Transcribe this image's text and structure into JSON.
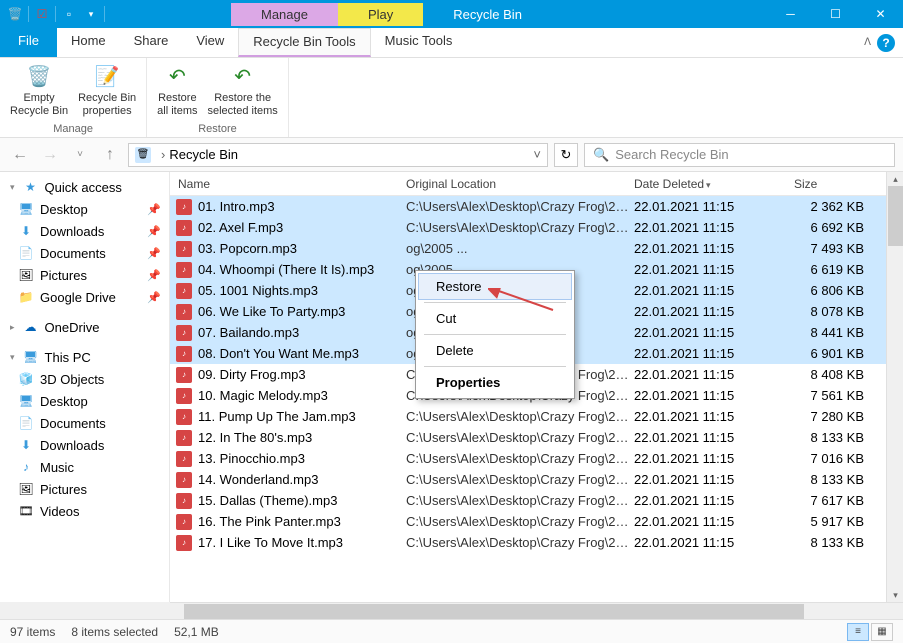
{
  "window": {
    "title": "Recycle Bin",
    "context_manage": "Manage",
    "context_play": "Play"
  },
  "tabs": {
    "file": "File",
    "home": "Home",
    "share": "Share",
    "view": "View",
    "recycle": "Recycle Bin Tools",
    "music": "Music Tools"
  },
  "ribbon": {
    "empty": "Empty\nRecycle Bin",
    "props": "Recycle Bin\nproperties",
    "restore_all": "Restore\nall items",
    "restore_sel": "Restore the\nselected items",
    "group_manage": "Manage",
    "group_restore": "Restore"
  },
  "address": {
    "path": "Recycle Bin",
    "search_placeholder": "Search Recycle Bin"
  },
  "sidebar": {
    "quick": "Quick access",
    "desktop": "Desktop",
    "downloads": "Downloads",
    "documents": "Documents",
    "pictures": "Pictures",
    "gdrive": "Google Drive",
    "onedrive": "OneDrive",
    "thispc": "This PC",
    "obj3d": "3D Objects",
    "desktop2": "Desktop",
    "documents2": "Documents",
    "downloads2": "Downloads",
    "music": "Music",
    "pictures2": "Pictures",
    "videos": "Videos"
  },
  "columns": {
    "name": "Name",
    "location": "Original Location",
    "deleted": "Date Deleted",
    "size": "Size"
  },
  "files": [
    {
      "sel": true,
      "n": "01. Intro.mp3",
      "l": "C:\\Users\\Alex\\Desktop\\Crazy Frog\\2005 ...",
      "d": "22.01.2021 11:15",
      "s": "2 362 KB"
    },
    {
      "sel": true,
      "n": "02. Axel F.mp3",
      "l": "C:\\Users\\Alex\\Desktop\\Crazy Frog\\2005 ...",
      "d": "22.01.2021 11:15",
      "s": "6 692 KB"
    },
    {
      "sel": true,
      "n": "03. Popcorn.mp3",
      "l": "og\\2005 ...",
      "d": "22.01.2021 11:15",
      "s": "7 493 KB"
    },
    {
      "sel": true,
      "n": "04. Whoompi (There It Is).mp3",
      "l": "og\\2005 ...",
      "d": "22.01.2021 11:15",
      "s": "6 619 KB"
    },
    {
      "sel": true,
      "n": "05. 1001 Nights.mp3",
      "l": "og\\2005 ...",
      "d": "22.01.2021 11:15",
      "s": "6 806 KB"
    },
    {
      "sel": true,
      "n": "06. We Like To Party.mp3",
      "l": "og\\2005 ...",
      "d": "22.01.2021 11:15",
      "s": "8 078 KB"
    },
    {
      "sel": true,
      "n": "07. Bailando.mp3",
      "l": "og\\2005 ...",
      "d": "22.01.2021 11:15",
      "s": "8 441 KB"
    },
    {
      "sel": true,
      "n": "08. Don't You Want Me.mp3",
      "l": "og\\2005 ...",
      "d": "22.01.2021 11:15",
      "s": "6 901 KB"
    },
    {
      "sel": false,
      "n": "09. Dirty Frog.mp3",
      "l": "C:\\Users\\Alex\\Desktop\\Crazy Frog\\2005 ...",
      "d": "22.01.2021 11:15",
      "s": "8 408 KB"
    },
    {
      "sel": false,
      "n": "10. Magic Melody.mp3",
      "l": "C:\\Users\\Alex\\Desktop\\Crazy Frog\\2005 ...",
      "d": "22.01.2021 11:15",
      "s": "7 561 KB"
    },
    {
      "sel": false,
      "n": "11. Pump Up The Jam.mp3",
      "l": "C:\\Users\\Alex\\Desktop\\Crazy Frog\\2005 ...",
      "d": "22.01.2021 11:15",
      "s": "7 280 KB"
    },
    {
      "sel": false,
      "n": "12. In The 80's.mp3",
      "l": "C:\\Users\\Alex\\Desktop\\Crazy Frog\\2005 ...",
      "d": "22.01.2021 11:15",
      "s": "8 133 KB"
    },
    {
      "sel": false,
      "n": "13. Pinocchio.mp3",
      "l": "C:\\Users\\Alex\\Desktop\\Crazy Frog\\2005 ...",
      "d": "22.01.2021 11:15",
      "s": "7 016 KB"
    },
    {
      "sel": false,
      "n": "14. Wonderland.mp3",
      "l": "C:\\Users\\Alex\\Desktop\\Crazy Frog\\2005 ...",
      "d": "22.01.2021 11:15",
      "s": "8 133 KB"
    },
    {
      "sel": false,
      "n": "15. Dallas (Theme).mp3",
      "l": "C:\\Users\\Alex\\Desktop\\Crazy Frog\\2005 ...",
      "d": "22.01.2021 11:15",
      "s": "7 617 KB"
    },
    {
      "sel": false,
      "n": "16. The Pink Panter.mp3",
      "l": "C:\\Users\\Alex\\Desktop\\Crazy Frog\\2005 ...",
      "d": "22.01.2021 11:15",
      "s": "5 917 KB"
    },
    {
      "sel": false,
      "n": "17. I Like To Move It.mp3",
      "l": "C:\\Users\\Alex\\Desktop\\Crazy Frog\\2005 ...",
      "d": "22.01.2021 11:15",
      "s": "8 133 KB"
    }
  ],
  "context_menu": {
    "restore": "Restore",
    "cut": "Cut",
    "delete": "Delete",
    "properties": "Properties"
  },
  "status": {
    "items": "97 items",
    "selected": "8 items selected",
    "size": "52,1 MB"
  }
}
